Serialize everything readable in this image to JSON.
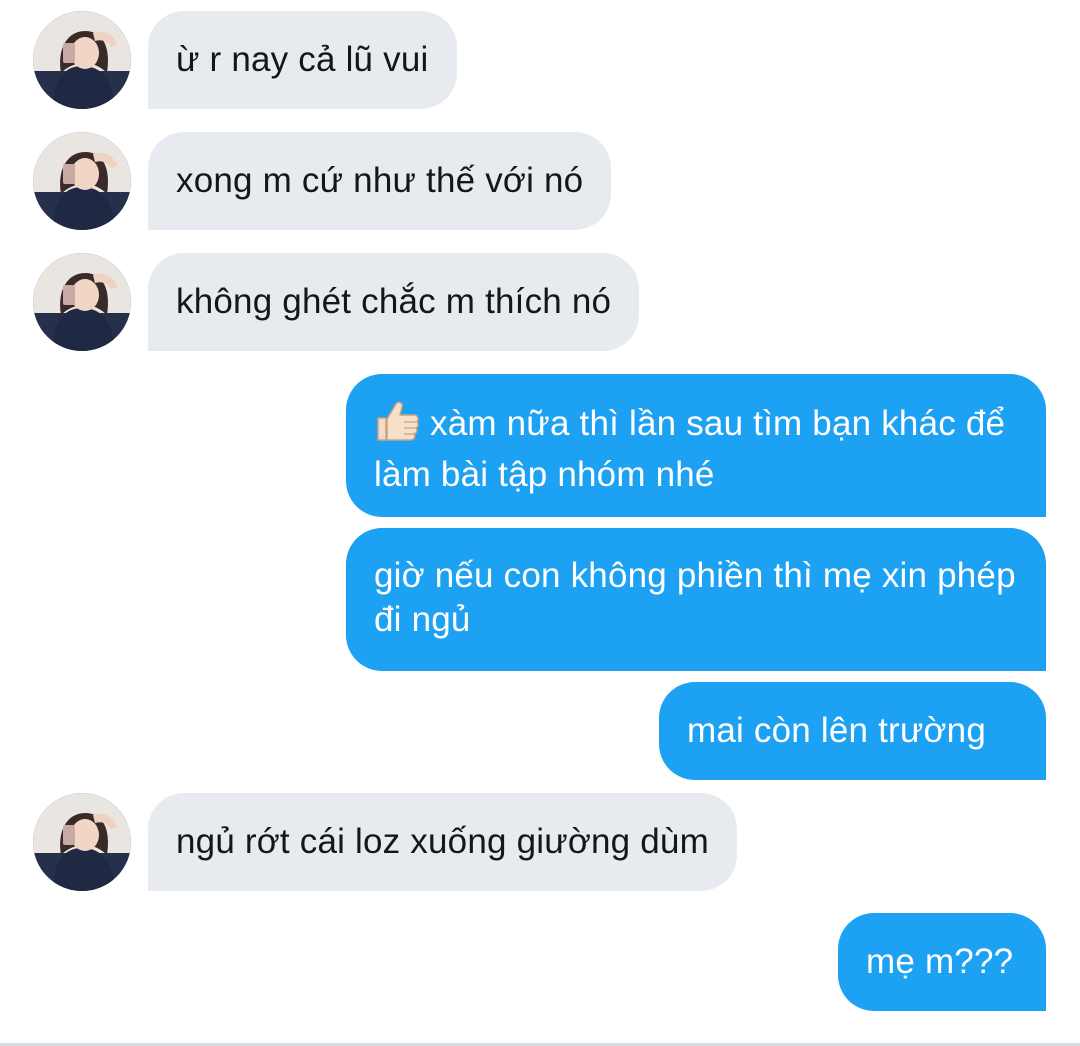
{
  "messages": [
    {
      "side": "in",
      "text": "ừ r nay cả lũ vui"
    },
    {
      "side": "in",
      "text": "xong m cứ như thế với nó"
    },
    {
      "side": "in",
      "text": "không ghét chắc m thích nó"
    },
    {
      "side": "out",
      "emoji": "thumbs-up-icon",
      "text": "xàm nữa thì lần sau tìm bạn khác để làm bài tập nhóm nhé"
    },
    {
      "side": "out",
      "text": "giờ nếu con không phiền thì mẹ xin phép đi ngủ"
    },
    {
      "side": "out",
      "text": "mai còn lên trường"
    },
    {
      "side": "in",
      "text": "ngủ rớt cái loz xuống giường dùm"
    },
    {
      "side": "out",
      "text": "mẹ m???"
    }
  ],
  "colors": {
    "incoming_bubble": "#e7ebef",
    "incoming_text": "#14171a",
    "outgoing_bubble": "#1da1f2",
    "outgoing_text": "#ffffff"
  }
}
